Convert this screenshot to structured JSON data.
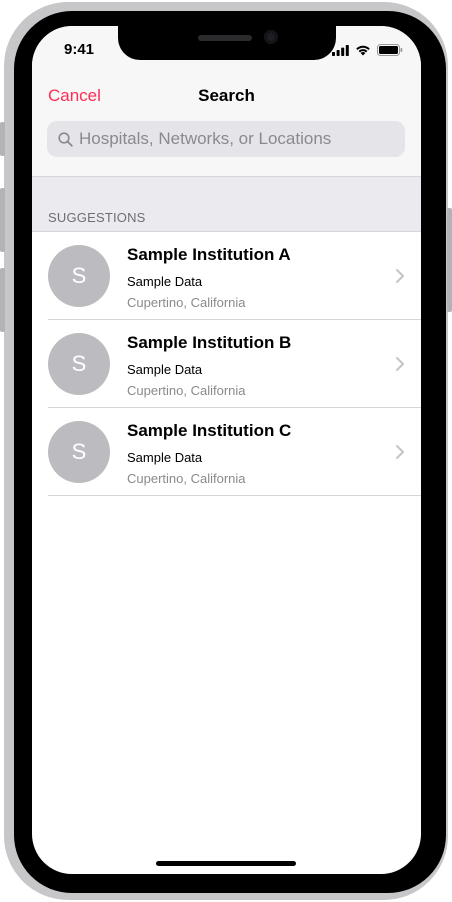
{
  "status": {
    "time": "9:41"
  },
  "nav": {
    "cancel_label": "Cancel",
    "title": "Search"
  },
  "search": {
    "placeholder": "Hospitals, Networks, or Locations",
    "value": ""
  },
  "section": {
    "header": "SUGGESTIONS"
  },
  "suggestions": [
    {
      "initial": "S",
      "name": "Sample Institution A",
      "subtitle": "Sample Data",
      "location": "Cupertino, California"
    },
    {
      "initial": "S",
      "name": "Sample Institution B",
      "subtitle": "Sample Data",
      "location": "Cupertino, California"
    },
    {
      "initial": "S",
      "name": "Sample Institution C",
      "subtitle": "Sample Data",
      "location": "Cupertino, California"
    }
  ],
  "colors": {
    "accent": "#ff2d55",
    "avatar": "#bcbcc0",
    "nav_background": "#f7f7f7",
    "section_background": "#eaeaef"
  },
  "icons": {
    "search": "search-icon",
    "chevron": "chevron-right-icon",
    "signal": "cellular-signal-icon",
    "wifi": "wifi-icon",
    "battery": "battery-icon"
  }
}
